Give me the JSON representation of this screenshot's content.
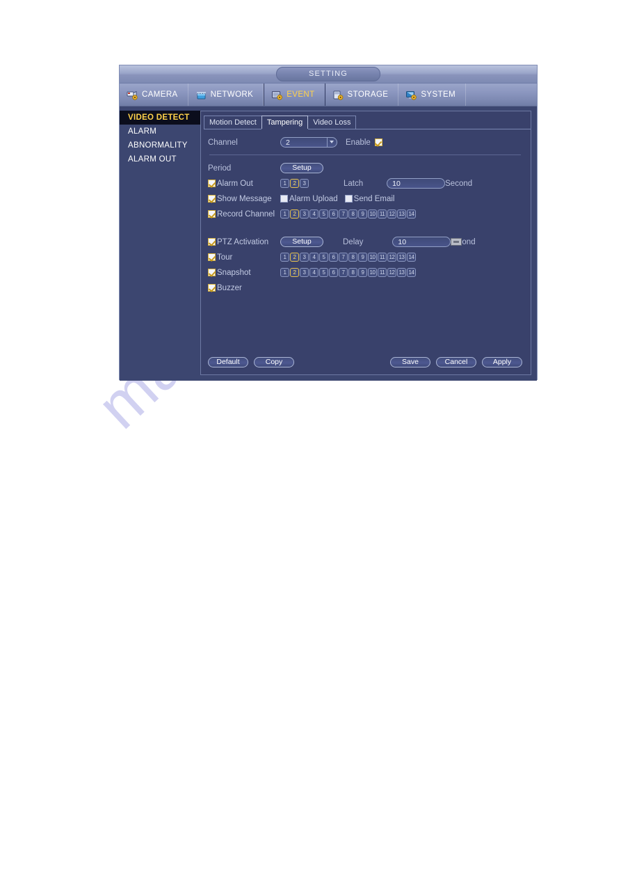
{
  "window": {
    "title": "SETTING"
  },
  "main_tabs": [
    {
      "label": "CAMERA",
      "icon": "camera-icon",
      "active": false
    },
    {
      "label": "NETWORK",
      "icon": "network-icon",
      "active": false
    },
    {
      "label": "EVENT",
      "icon": "event-icon",
      "active": true
    },
    {
      "label": "STORAGE",
      "icon": "storage-icon",
      "active": false
    },
    {
      "label": "SYSTEM",
      "icon": "system-icon",
      "active": false
    }
  ],
  "sidebar": {
    "items": [
      {
        "label": "VIDEO DETECT",
        "active": true
      },
      {
        "label": "ALARM",
        "active": false
      },
      {
        "label": "ABNORMALITY",
        "active": false
      },
      {
        "label": "ALARM OUT",
        "active": false
      }
    ]
  },
  "sub_tabs": [
    {
      "label": "Motion Detect",
      "active": false
    },
    {
      "label": "Tampering",
      "active": true
    },
    {
      "label": "Video Loss",
      "active": false
    }
  ],
  "form": {
    "channel_label": "Channel",
    "channel_value": "2",
    "enable_label": "Enable",
    "enable_checked": true,
    "period_label": "Period",
    "period_setup_label": "Setup",
    "alarm_out_label": "Alarm Out",
    "alarm_out_checked": true,
    "alarm_out_channels": [
      "1",
      "2",
      "3"
    ],
    "alarm_out_selected": [
      "2"
    ],
    "latch_label": "Latch",
    "latch_value": "10",
    "latch_unit": "Second",
    "show_message_label": "Show Message",
    "show_message_checked": true,
    "alarm_upload_label": "Alarm Upload",
    "alarm_upload_checked": false,
    "send_email_label": "Send Email",
    "send_email_checked": false,
    "record_channel_label": "Record Channel",
    "record_channel_checked": true,
    "record_channels": [
      "1",
      "2",
      "3",
      "4",
      "5",
      "6",
      "7",
      "8",
      "9",
      "10",
      "11",
      "12",
      "13",
      "14"
    ],
    "record_selected": [
      "2"
    ],
    "ptz_activation_label": "PTZ Activation",
    "ptz_activation_checked": true,
    "ptz_setup_label": "Setup",
    "delay_label": "Delay",
    "delay_value": "10",
    "delay_unit": "ond",
    "tour_label": "Tour",
    "tour_checked": true,
    "tour_channels": [
      "1",
      "2",
      "3",
      "4",
      "5",
      "6",
      "7",
      "8",
      "9",
      "10",
      "11",
      "12",
      "13",
      "14"
    ],
    "tour_selected": [
      "2"
    ],
    "snapshot_label": "Snapshot",
    "snapshot_checked": true,
    "snapshot_channels": [
      "1",
      "2",
      "3",
      "4",
      "5",
      "6",
      "7",
      "8",
      "9",
      "10",
      "11",
      "12",
      "13",
      "14"
    ],
    "snapshot_selected": [
      "2"
    ],
    "buzzer_label": "Buzzer",
    "buzzer_checked": true
  },
  "footer": {
    "default_label": "Default",
    "copy_label": "Copy",
    "save_label": "Save",
    "cancel_label": "Cancel",
    "apply_label": "Apply"
  },
  "watermark": {
    "text": "manualshive.com"
  },
  "colors": {
    "accent_yellow": "#ffd24a",
    "panel_bg": "#39416b",
    "window_bg": "#3c4670",
    "header_bg": "#8b96bf",
    "checkbox_border": "#d8b23a"
  }
}
